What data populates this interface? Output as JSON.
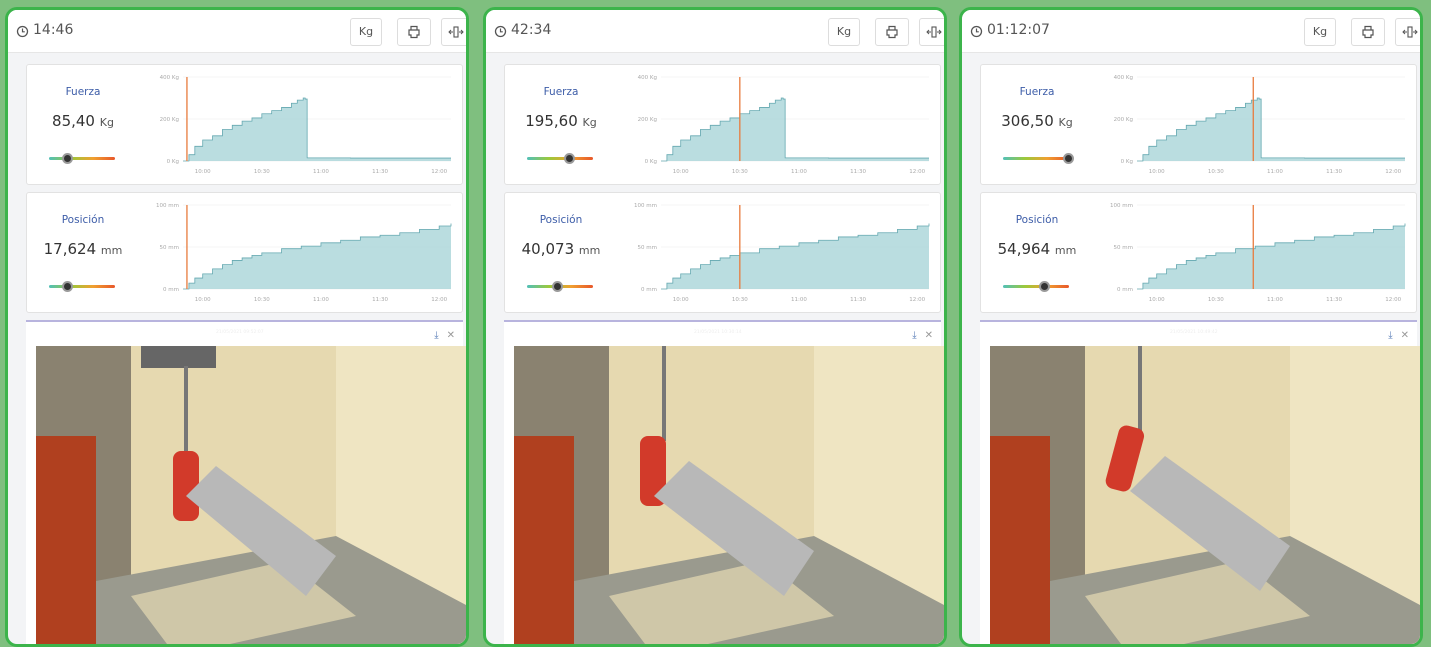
{
  "colors": {
    "frame": "#3cb44b",
    "label": "#3d5da8",
    "area": "#a9d4d8",
    "stroke": "#64a8b0",
    "marker": "#e87b3d"
  },
  "icons": {
    "clock": "clock-icon",
    "print": "printer-icon",
    "expand": "expand-icon",
    "download": "download-icon",
    "close": "close-icon"
  },
  "panels": [
    {
      "time": "14:46",
      "unit_button": "Kg",
      "force": {
        "label": "Fuerza",
        "value": "85,40",
        "unit": "Kg",
        "level": 0.28
      },
      "position": {
        "label": "Posición",
        "value": "17,624",
        "unit": "mm",
        "level": 0.28
      },
      "image": {
        "timestamp": "21/05/2021 09:52:07"
      }
    },
    {
      "time": "42:34",
      "unit_button": "Kg",
      "force": {
        "label": "Fuerza",
        "value": "195,60",
        "unit": "Kg",
        "level": 0.63
      },
      "position": {
        "label": "Posición",
        "value": "40,073",
        "unit": "mm",
        "level": 0.46
      },
      "image": {
        "timestamp": "21/05/2021 10:30:14"
      }
    },
    {
      "time": "01:12:07",
      "unit_button": "Kg",
      "force": {
        "label": "Fuerza",
        "value": "306,50",
        "unit": "Kg",
        "level": 0.98
      },
      "position": {
        "label": "Posición",
        "value": "54,964",
        "unit": "mm",
        "level": 0.62
      },
      "image": {
        "timestamp": "21/05/2021 10:49:42"
      }
    }
  ],
  "chart_data": [
    {
      "type": "area",
      "title": "Fuerza",
      "y_ticks": [
        "400 Kg",
        "200 Kg",
        "0 Kg"
      ],
      "ylim": [
        0,
        400
      ],
      "x_ticks": [
        "10:00",
        "10:30",
        "11:00",
        "11:30",
        "12:00"
      ],
      "xlim": [
        "09:50",
        "12:06"
      ],
      "marker_time": "09:52",
      "x": [
        "09:50",
        "09:53",
        "09:56",
        "10:00",
        "10:05",
        "10:10",
        "10:15",
        "10:20",
        "10:25",
        "10:30",
        "10:35",
        "10:40",
        "10:45",
        "10:48",
        "10:51",
        "10:52",
        "10:53",
        "11:00",
        "11:15",
        "11:30",
        "11:45",
        "12:00",
        "12:06"
      ],
      "values": [
        0,
        30,
        70,
        100,
        120,
        150,
        170,
        190,
        205,
        225,
        240,
        255,
        275,
        290,
        300,
        295,
        15,
        15,
        14,
        14,
        14,
        14,
        14
      ]
    },
    {
      "type": "area",
      "title": "Fuerza",
      "y_ticks": [
        "400 Kg",
        "200 Kg",
        "0 Kg"
      ],
      "ylim": [
        0,
        400
      ],
      "x_ticks": [
        "10:00",
        "10:30",
        "11:00",
        "11:30",
        "12:00"
      ],
      "xlim": [
        "09:50",
        "12:06"
      ],
      "marker_time": "10:30",
      "x": [
        "09:50",
        "09:53",
        "09:56",
        "10:00",
        "10:05",
        "10:10",
        "10:15",
        "10:20",
        "10:25",
        "10:30",
        "10:35",
        "10:40",
        "10:45",
        "10:48",
        "10:51",
        "10:52",
        "10:53",
        "11:00",
        "11:15",
        "11:30",
        "11:45",
        "12:00",
        "12:06"
      ],
      "values": [
        0,
        30,
        70,
        100,
        120,
        150,
        170,
        190,
        205,
        225,
        240,
        255,
        275,
        290,
        300,
        295,
        15,
        15,
        14,
        14,
        14,
        14,
        14
      ]
    },
    {
      "type": "area",
      "title": "Fuerza",
      "y_ticks": [
        "400 Kg",
        "200 Kg",
        "0 Kg"
      ],
      "ylim": [
        0,
        400
      ],
      "x_ticks": [
        "10:00",
        "10:30",
        "11:00",
        "11:30",
        "12:00"
      ],
      "xlim": [
        "09:50",
        "12:06"
      ],
      "marker_time": "10:49",
      "x": [
        "09:50",
        "09:53",
        "09:56",
        "10:00",
        "10:05",
        "10:10",
        "10:15",
        "10:20",
        "10:25",
        "10:30",
        "10:35",
        "10:40",
        "10:45",
        "10:48",
        "10:51",
        "10:52",
        "10:53",
        "11:00",
        "11:15",
        "11:30",
        "11:45",
        "12:00",
        "12:06"
      ],
      "values": [
        0,
        30,
        70,
        100,
        120,
        150,
        170,
        190,
        205,
        225,
        240,
        255,
        275,
        290,
        300,
        295,
        15,
        15,
        14,
        14,
        14,
        14,
        14
      ]
    },
    {
      "type": "area",
      "title": "Posición",
      "y_ticks": [
        "100 mm",
        "50 mm",
        "0 mm"
      ],
      "ylim": [
        0,
        100
      ],
      "x_ticks": [
        "10:00",
        "10:30",
        "11:00",
        "11:30",
        "12:00"
      ],
      "xlim": [
        "09:50",
        "12:06"
      ],
      "marker_time": "09:52",
      "x": [
        "09:50",
        "09:53",
        "09:56",
        "10:00",
        "10:05",
        "10:10",
        "10:15",
        "10:20",
        "10:25",
        "10:30",
        "10:40",
        "10:50",
        "11:00",
        "11:10",
        "11:20",
        "11:30",
        "11:40",
        "11:50",
        "12:00",
        "12:06"
      ],
      "values": [
        0,
        7,
        13,
        18,
        24,
        29,
        34,
        37,
        40,
        43,
        48,
        51,
        55,
        58,
        62,
        64,
        67,
        71,
        75,
        78
      ]
    },
    {
      "type": "area",
      "title": "Posición",
      "y_ticks": [
        "100 mm",
        "50 mm",
        "0 mm"
      ],
      "ylim": [
        0,
        100
      ],
      "x_ticks": [
        "10:00",
        "10:30",
        "11:00",
        "11:30",
        "12:00"
      ],
      "xlim": [
        "09:50",
        "12:06"
      ],
      "marker_time": "10:30",
      "x": [
        "09:50",
        "09:53",
        "09:56",
        "10:00",
        "10:05",
        "10:10",
        "10:15",
        "10:20",
        "10:25",
        "10:30",
        "10:40",
        "10:50",
        "11:00",
        "11:10",
        "11:20",
        "11:30",
        "11:40",
        "11:50",
        "12:00",
        "12:06"
      ],
      "values": [
        0,
        7,
        13,
        18,
        24,
        29,
        34,
        37,
        40,
        43,
        48,
        51,
        55,
        58,
        62,
        64,
        67,
        71,
        75,
        78
      ]
    },
    {
      "type": "area",
      "title": "Posición",
      "y_ticks": [
        "100 mm",
        "50 mm",
        "0 mm"
      ],
      "ylim": [
        0,
        100
      ],
      "x_ticks": [
        "10:00",
        "10:30",
        "11:00",
        "11:30",
        "12:00"
      ],
      "xlim": [
        "09:50",
        "12:06"
      ],
      "marker_time": "10:49",
      "x": [
        "09:50",
        "09:53",
        "09:56",
        "10:00",
        "10:05",
        "10:10",
        "10:15",
        "10:20",
        "10:25",
        "10:30",
        "10:40",
        "10:50",
        "11:00",
        "11:10",
        "11:20",
        "11:30",
        "11:40",
        "11:50",
        "12:00",
        "12:06"
      ],
      "values": [
        0,
        7,
        13,
        18,
        24,
        29,
        34,
        37,
        40,
        43,
        48,
        51,
        55,
        58,
        62,
        64,
        67,
        71,
        75,
        78
      ]
    }
  ]
}
